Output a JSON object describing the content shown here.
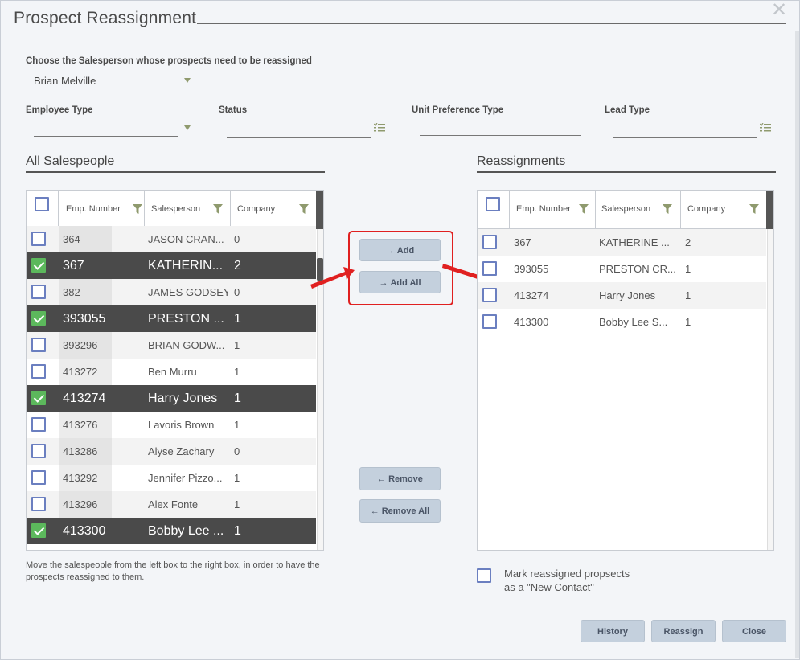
{
  "dialog": {
    "title": "Prospect Reassignment",
    "close_icon": "close-icon"
  },
  "filters": {
    "salesperson_label": "Choose the Salesperson whose prospects need to be reassigned",
    "salesperson_value": "Brian Melville",
    "employee_type_label": "Employee Type",
    "employee_type_value": "",
    "status_label": "Status",
    "status_value": "",
    "unit_pref_label": "Unit Preference Type",
    "unit_pref_value": "",
    "lead_type_label": "Lead Type",
    "lead_type_value": ""
  },
  "all_salespeople": {
    "title": "All Salespeople",
    "columns": [
      "Emp. Number",
      "Salesperson",
      "Company"
    ],
    "rows": [
      {
        "emp": "364",
        "name": "JASON CRAN...",
        "company": "0",
        "checked": false
      },
      {
        "emp": "367",
        "name": "KATHERIN...",
        "company": "2",
        "checked": true
      },
      {
        "emp": "382",
        "name": "JAMES GODSEY",
        "company": "0",
        "checked": false
      },
      {
        "emp": "393055",
        "name": "PRESTON ...",
        "company": "1",
        "checked": true
      },
      {
        "emp": "393296",
        "name": "BRIAN GODW...",
        "company": "1",
        "checked": false
      },
      {
        "emp": "413272",
        "name": "Ben Murru",
        "company": "1",
        "checked": false
      },
      {
        "emp": "413274",
        "name": "Harry Jones",
        "company": "1",
        "checked": true
      },
      {
        "emp": "413276",
        "name": "Lavoris Brown",
        "company": "1",
        "checked": false
      },
      {
        "emp": "413286",
        "name": "Alyse Zachary",
        "company": "0",
        "checked": false
      },
      {
        "emp": "413292",
        "name": "Jennifer Pizzo...",
        "company": "1",
        "checked": false
      },
      {
        "emp": "413296",
        "name": "Alex Fonte",
        "company": "1",
        "checked": false
      },
      {
        "emp": "413300",
        "name": "Bobby Lee ...",
        "company": "1",
        "checked": true
      }
    ],
    "note": "Move the salespeople from the left box to the right box, in order to have the prospects reassigned to them."
  },
  "transfer": {
    "add_label": "Add",
    "add_all_label": "Add All",
    "remove_label": "Remove",
    "remove_all_label": "Remove All",
    "right_arrow": "→",
    "left_arrow": "←"
  },
  "reassignments": {
    "title": "Reassignments",
    "columns": [
      "Emp. Number",
      "Salesperson",
      "Company"
    ],
    "rows": [
      {
        "emp": "367",
        "name": "KATHERINE ...",
        "company": "2",
        "checked": false
      },
      {
        "emp": "393055",
        "name": "PRESTON CR...",
        "company": "1",
        "checked": false
      },
      {
        "emp": "413274",
        "name": "Harry Jones",
        "company": "1",
        "checked": false
      },
      {
        "emp": "413300",
        "name": "Bobby Lee S...",
        "company": "1",
        "checked": false
      }
    ],
    "mark_label_line1": "Mark reassigned propsects",
    "mark_label_line2": "as a \"New Contact\"",
    "mark_checked": false
  },
  "footer": {
    "history_label": "History",
    "reassign_label": "Reassign",
    "close_label": "Close"
  },
  "colors": {
    "annotation_red": "#e02020",
    "selected_row": "#4a4a4a",
    "check_green": "#5cb85c",
    "button_bg": "#c4d0dd"
  }
}
